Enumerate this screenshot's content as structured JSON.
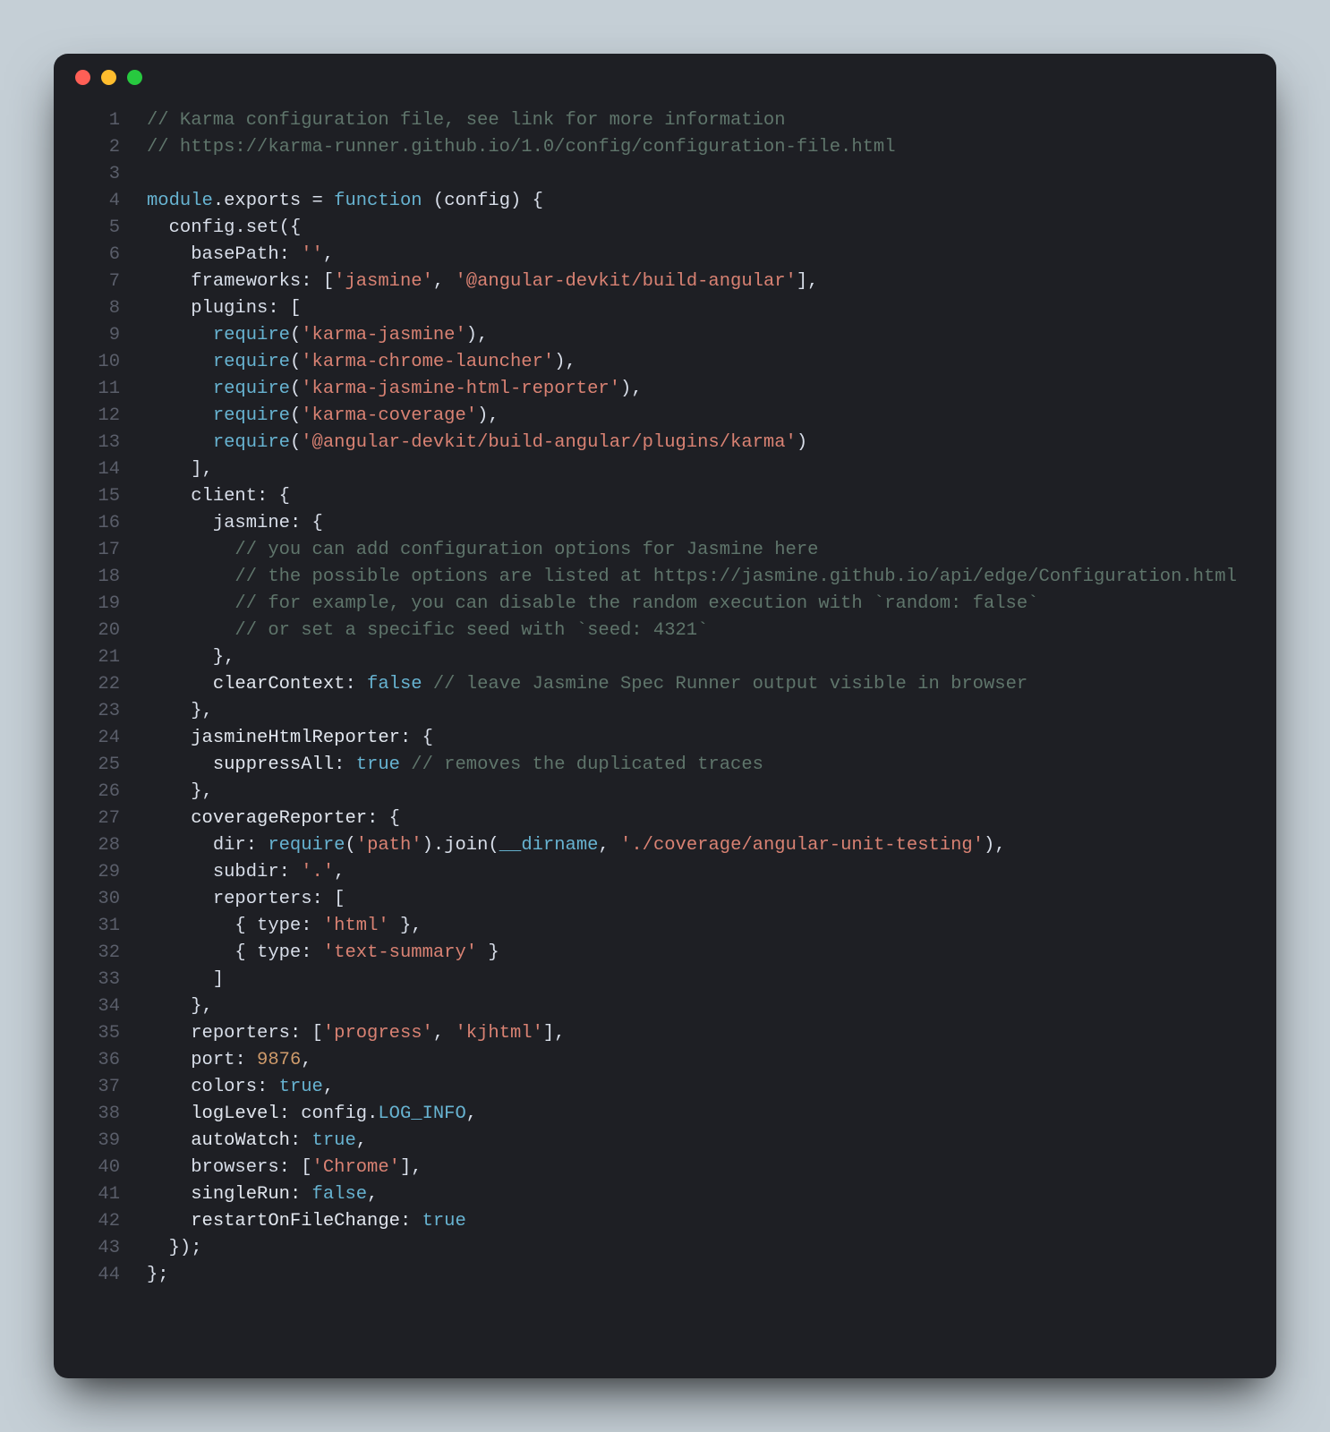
{
  "window": {
    "title": ""
  },
  "code": {
    "lines": [
      {
        "n": 1,
        "t": [
          [
            "cm",
            "// Karma configuration file, see link for more information"
          ]
        ]
      },
      {
        "n": 2,
        "t": [
          [
            "cm",
            "// https://karma-runner.github.io/1.0/config/configuration-file.html"
          ]
        ]
      },
      {
        "n": 3,
        "t": [
          [
            "op",
            ""
          ]
        ]
      },
      {
        "n": 4,
        "t": [
          [
            "kw",
            "module"
          ],
          [
            "op",
            "."
          ],
          [
            "prop",
            "exports"
          ],
          [
            "op",
            " = "
          ],
          [
            "kw",
            "function"
          ],
          [
            "op",
            " ("
          ],
          [
            "prop",
            "config"
          ],
          [
            "op",
            ") {"
          ]
        ]
      },
      {
        "n": 5,
        "t": [
          [
            "op",
            "  "
          ],
          [
            "prop",
            "config"
          ],
          [
            "op",
            "."
          ],
          [
            "fn",
            "set"
          ],
          [
            "op",
            "({"
          ]
        ]
      },
      {
        "n": 6,
        "t": [
          [
            "op",
            "    "
          ],
          [
            "prop",
            "basePath"
          ],
          [
            "op",
            ": "
          ],
          [
            "str",
            "''"
          ],
          [
            "op",
            ","
          ]
        ]
      },
      {
        "n": 7,
        "t": [
          [
            "op",
            "    "
          ],
          [
            "prop",
            "frameworks"
          ],
          [
            "op",
            ": ["
          ],
          [
            "str",
            "'jasmine'"
          ],
          [
            "op",
            ", "
          ],
          [
            "str",
            "'@angular-devkit/build-angular'"
          ],
          [
            "op",
            "],"
          ]
        ]
      },
      {
        "n": 8,
        "t": [
          [
            "op",
            "    "
          ],
          [
            "prop",
            "plugins"
          ],
          [
            "op",
            ": ["
          ]
        ]
      },
      {
        "n": 9,
        "t": [
          [
            "op",
            "      "
          ],
          [
            "kw",
            "require"
          ],
          [
            "op",
            "("
          ],
          [
            "str",
            "'karma-jasmine'"
          ],
          [
            "op",
            "),"
          ]
        ]
      },
      {
        "n": 10,
        "t": [
          [
            "op",
            "      "
          ],
          [
            "kw",
            "require"
          ],
          [
            "op",
            "("
          ],
          [
            "str",
            "'karma-chrome-launcher'"
          ],
          [
            "op",
            "),"
          ]
        ]
      },
      {
        "n": 11,
        "t": [
          [
            "op",
            "      "
          ],
          [
            "kw",
            "require"
          ],
          [
            "op",
            "("
          ],
          [
            "str",
            "'karma-jasmine-html-reporter'"
          ],
          [
            "op",
            "),"
          ]
        ]
      },
      {
        "n": 12,
        "t": [
          [
            "op",
            "      "
          ],
          [
            "kw",
            "require"
          ],
          [
            "op",
            "("
          ],
          [
            "str",
            "'karma-coverage'"
          ],
          [
            "op",
            "),"
          ]
        ]
      },
      {
        "n": 13,
        "t": [
          [
            "op",
            "      "
          ],
          [
            "kw",
            "require"
          ],
          [
            "op",
            "("
          ],
          [
            "str",
            "'@angular-devkit/build-angular/plugins/karma'"
          ],
          [
            "op",
            ")"
          ]
        ]
      },
      {
        "n": 14,
        "t": [
          [
            "op",
            "    ],"
          ]
        ]
      },
      {
        "n": 15,
        "t": [
          [
            "op",
            "    "
          ],
          [
            "prop",
            "client"
          ],
          [
            "op",
            ": {"
          ]
        ]
      },
      {
        "n": 16,
        "t": [
          [
            "op",
            "      "
          ],
          [
            "prop",
            "jasmine"
          ],
          [
            "op",
            ": {"
          ]
        ]
      },
      {
        "n": 17,
        "t": [
          [
            "op",
            "        "
          ],
          [
            "cm",
            "// you can add configuration options for Jasmine here"
          ]
        ]
      },
      {
        "n": 18,
        "t": [
          [
            "op",
            "        "
          ],
          [
            "cm",
            "// the possible options are listed at https://jasmine.github.io/api/edge/Configuration.html"
          ]
        ]
      },
      {
        "n": 19,
        "t": [
          [
            "op",
            "        "
          ],
          [
            "cm",
            "// for example, you can disable the random execution with `random: false`"
          ]
        ]
      },
      {
        "n": 20,
        "t": [
          [
            "op",
            "        "
          ],
          [
            "cm",
            "// or set a specific seed with `seed: 4321`"
          ]
        ]
      },
      {
        "n": 21,
        "t": [
          [
            "op",
            "      },"
          ]
        ]
      },
      {
        "n": 22,
        "t": [
          [
            "op",
            "      "
          ],
          [
            "prop-b",
            "clearContext"
          ],
          [
            "op",
            ": "
          ],
          [
            "bool",
            "false"
          ],
          [
            "op",
            " "
          ],
          [
            "cm",
            "// leave Jasmine Spec Runner output visible in browser"
          ]
        ]
      },
      {
        "n": 23,
        "t": [
          [
            "op",
            "    },"
          ]
        ]
      },
      {
        "n": 24,
        "t": [
          [
            "op",
            "    "
          ],
          [
            "prop-b",
            "jasmineHtmlReporter"
          ],
          [
            "op",
            ": {"
          ]
        ]
      },
      {
        "n": 25,
        "t": [
          [
            "op",
            "      "
          ],
          [
            "prop-b",
            "suppressAll"
          ],
          [
            "op",
            ": "
          ],
          [
            "bool",
            "true"
          ],
          [
            "op",
            " "
          ],
          [
            "cm",
            "// removes the duplicated traces"
          ]
        ]
      },
      {
        "n": 26,
        "t": [
          [
            "op",
            "    },"
          ]
        ]
      },
      {
        "n": 27,
        "t": [
          [
            "op",
            "    "
          ],
          [
            "prop-b",
            "coverageReporter"
          ],
          [
            "op",
            ": {"
          ]
        ]
      },
      {
        "n": 28,
        "t": [
          [
            "op",
            "      "
          ],
          [
            "prop",
            "dir"
          ],
          [
            "op",
            ": "
          ],
          [
            "kw",
            "require"
          ],
          [
            "op",
            "("
          ],
          [
            "str",
            "'path'"
          ],
          [
            "op",
            ")."
          ],
          [
            "fn",
            "join"
          ],
          [
            "op",
            "("
          ],
          [
            "const",
            "__dirname"
          ],
          [
            "op",
            ", "
          ],
          [
            "str",
            "'./coverage/angular-unit-testing'"
          ],
          [
            "op",
            "),"
          ]
        ]
      },
      {
        "n": 29,
        "t": [
          [
            "op",
            "      "
          ],
          [
            "prop",
            "subdir"
          ],
          [
            "op",
            ": "
          ],
          [
            "str",
            "'.'"
          ],
          [
            "op",
            ","
          ]
        ]
      },
      {
        "n": 30,
        "t": [
          [
            "op",
            "      "
          ],
          [
            "prop",
            "reporters"
          ],
          [
            "op",
            ": ["
          ]
        ]
      },
      {
        "n": 31,
        "t": [
          [
            "op",
            "        { "
          ],
          [
            "prop",
            "type"
          ],
          [
            "op",
            ": "
          ],
          [
            "str",
            "'html'"
          ],
          [
            "op",
            " },"
          ]
        ]
      },
      {
        "n": 32,
        "t": [
          [
            "op",
            "        { "
          ],
          [
            "prop",
            "type"
          ],
          [
            "op",
            ": "
          ],
          [
            "str",
            "'text-summary'"
          ],
          [
            "op",
            " }"
          ]
        ]
      },
      {
        "n": 33,
        "t": [
          [
            "op",
            "      ]"
          ]
        ]
      },
      {
        "n": 34,
        "t": [
          [
            "op",
            "    },"
          ]
        ]
      },
      {
        "n": 35,
        "t": [
          [
            "op",
            "    "
          ],
          [
            "prop",
            "reporters"
          ],
          [
            "op",
            ": ["
          ],
          [
            "str",
            "'progress'"
          ],
          [
            "op",
            ", "
          ],
          [
            "str",
            "'kjhtml'"
          ],
          [
            "op",
            "],"
          ]
        ]
      },
      {
        "n": 36,
        "t": [
          [
            "op",
            "    "
          ],
          [
            "prop",
            "port"
          ],
          [
            "op",
            ": "
          ],
          [
            "num",
            "9876"
          ],
          [
            "op",
            ","
          ]
        ]
      },
      {
        "n": 37,
        "t": [
          [
            "op",
            "    "
          ],
          [
            "prop",
            "colors"
          ],
          [
            "op",
            ": "
          ],
          [
            "bool",
            "true"
          ],
          [
            "op",
            ","
          ]
        ]
      },
      {
        "n": 38,
        "t": [
          [
            "op",
            "    "
          ],
          [
            "prop-b",
            "logLevel"
          ],
          [
            "op",
            ": "
          ],
          [
            "prop",
            "config"
          ],
          [
            "op",
            "."
          ],
          [
            "const",
            "LOG_INFO"
          ],
          [
            "op",
            ","
          ]
        ]
      },
      {
        "n": 39,
        "t": [
          [
            "op",
            "    "
          ],
          [
            "prop-b",
            "autoWatch"
          ],
          [
            "op",
            ": "
          ],
          [
            "bool",
            "true"
          ],
          [
            "op",
            ","
          ]
        ]
      },
      {
        "n": 40,
        "t": [
          [
            "op",
            "    "
          ],
          [
            "prop",
            "browsers"
          ],
          [
            "op",
            ": ["
          ],
          [
            "str",
            "'Chrome'"
          ],
          [
            "op",
            "],"
          ]
        ]
      },
      {
        "n": 41,
        "t": [
          [
            "op",
            "    "
          ],
          [
            "prop-b",
            "singleRun"
          ],
          [
            "op",
            ": "
          ],
          [
            "bool",
            "false"
          ],
          [
            "op",
            ","
          ]
        ]
      },
      {
        "n": 42,
        "t": [
          [
            "op",
            "    "
          ],
          [
            "prop-b",
            "restartOnFileChange"
          ],
          [
            "op",
            ": "
          ],
          [
            "bool",
            "true"
          ]
        ]
      },
      {
        "n": 43,
        "t": [
          [
            "op",
            "  });"
          ]
        ]
      },
      {
        "n": 44,
        "t": [
          [
            "op",
            "};"
          ]
        ]
      }
    ]
  }
}
